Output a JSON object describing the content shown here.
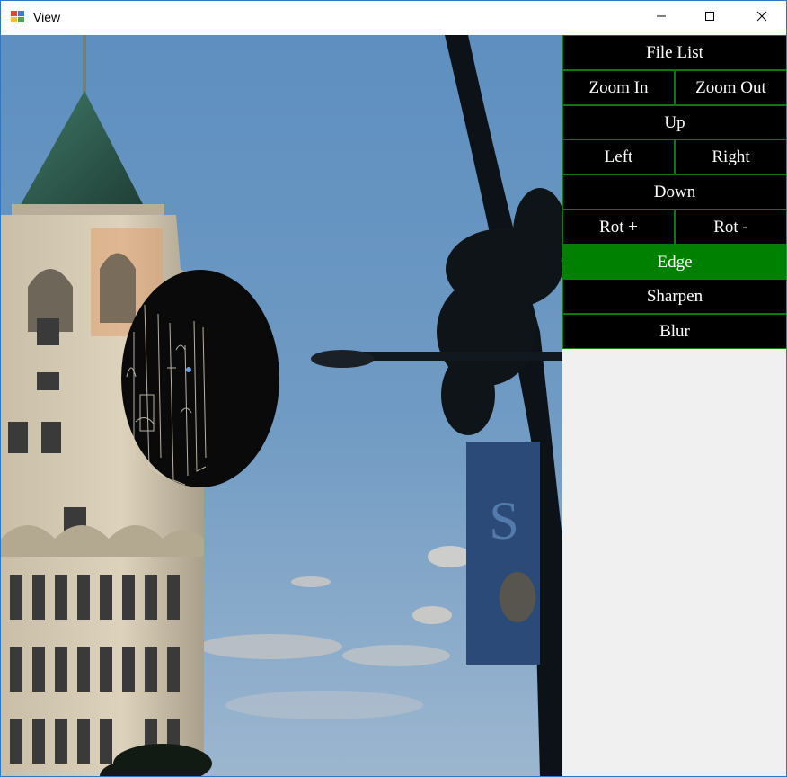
{
  "window": {
    "title": "View",
    "app_icon": "app-icon",
    "controls": {
      "minimize": "minimize-icon",
      "maximize": "maximize-icon",
      "close": "close-icon"
    }
  },
  "image_view": {
    "content": "photo-street-scene",
    "overlay": "edge-filter-ellipse"
  },
  "panel": {
    "file_list": "File List",
    "zoom_in": "Zoom In",
    "zoom_out": "Zoom Out",
    "up": "Up",
    "left": "Left",
    "right": "Right",
    "down": "Down",
    "rot_plus": "Rot +",
    "rot_minus": "Rot -",
    "edge": "Edge",
    "sharpen": "Sharpen",
    "blur": "Blur",
    "active_item": "Edge"
  },
  "colors": {
    "button_bg": "#000000",
    "button_border": "#0b7a0b",
    "active_bg": "#008000",
    "button_text": "#ffffff",
    "panel_bg": "#f0f0f0"
  }
}
